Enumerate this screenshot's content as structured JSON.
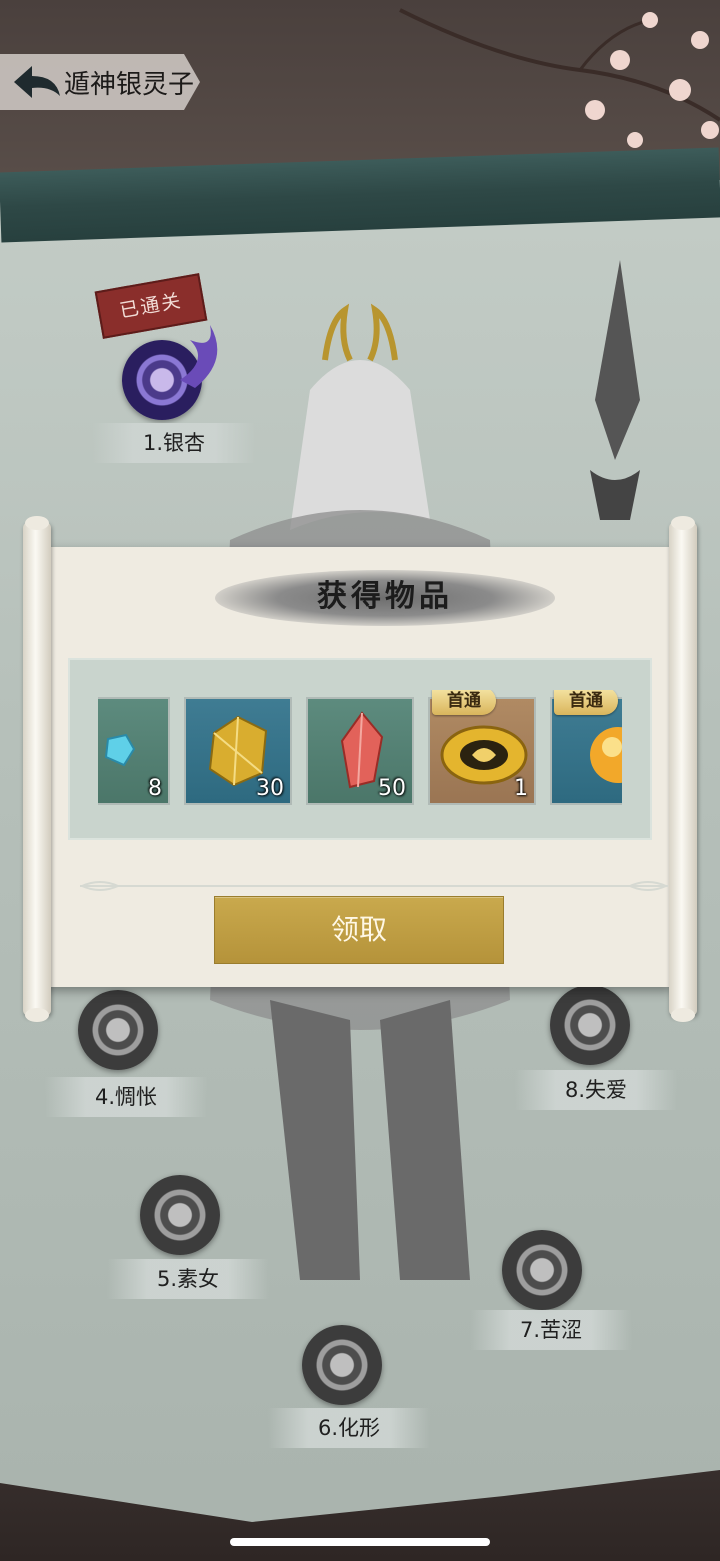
{
  "header": {
    "back_icon": "back-arrow-icon",
    "title": "遁神银灵子"
  },
  "stages": [
    {
      "label": "1.银杏",
      "status": "已通关"
    },
    {
      "label": "4.惆怅"
    },
    {
      "label": "8.失爱"
    },
    {
      "label": "5.素女"
    },
    {
      "label": "7.苦涩"
    },
    {
      "label": "6.化形"
    }
  ],
  "dialog": {
    "title": "获得物品",
    "items": [
      {
        "icon": "blue-gem-icon",
        "count": "8",
        "rarity": "green",
        "first_clear": false
      },
      {
        "icon": "gold-ore-icon",
        "count": "30",
        "rarity": "blue",
        "first_clear": false
      },
      {
        "icon": "red-crystal-icon",
        "count": "50",
        "rarity": "green",
        "first_clear": false
      },
      {
        "icon": "gold-coin-icon",
        "count": "1",
        "rarity": "brown",
        "first_clear": true,
        "badge": "首通"
      },
      {
        "icon": "gold-orb-icon",
        "count": "",
        "rarity": "blue",
        "first_clear": true,
        "badge": "首通"
      }
    ],
    "claim_label": "领取"
  }
}
